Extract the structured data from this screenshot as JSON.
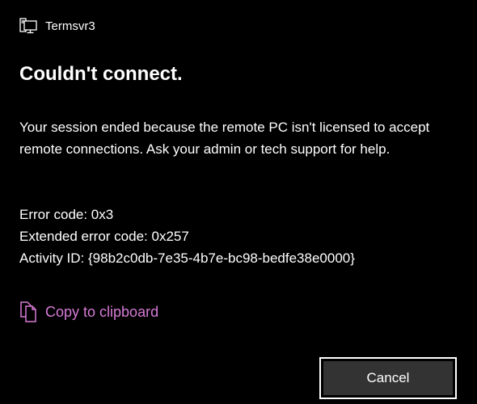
{
  "window": {
    "title": "Termsvr3",
    "icon": "remote-desktop-icon"
  },
  "dialog": {
    "heading": "Couldn't connect.",
    "message": "Your session ended because the remote PC isn't licensed to accept remote connections. Ask your admin or tech support for help.",
    "error_code": "Error code: 0x3",
    "extended_error_code": "Extended error code: 0x257",
    "activity_id": "Activity ID: {98b2c0db-7e35-4b7e-bc98-bedfe38e0000}"
  },
  "actions": {
    "copy_label": "Copy to clipboard",
    "copy_icon": "copy-icon",
    "cancel_label": "Cancel"
  },
  "colors": {
    "background": "#000000",
    "text": "#ffffff",
    "link_accent": "#d77bd6",
    "button_fill": "#333333",
    "button_border": "#ffffff"
  }
}
